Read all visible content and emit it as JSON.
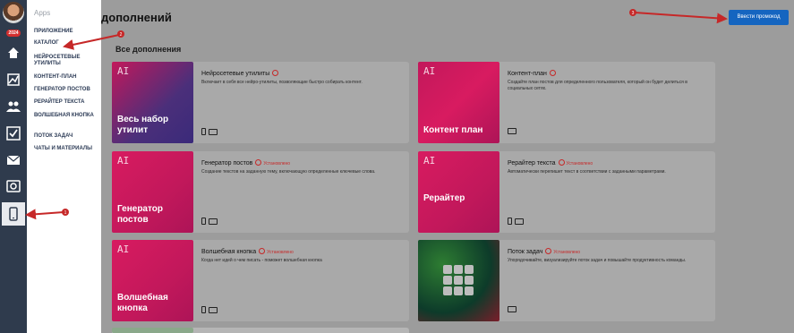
{
  "sidebar": {
    "badge": "2024",
    "apps_title": "Apps",
    "items": [
      {
        "label": "ПРИЛОЖЕНИЕ"
      },
      {
        "label": "КАТАЛОГ"
      },
      {
        "label": "НЕЙРОСЕТЕВЫЕ УТИЛИТЫ"
      },
      {
        "label": "КОНТЕНТ-ПЛАН"
      },
      {
        "label": "ГЕНЕРАТОР ПОСТОВ"
      },
      {
        "label": "РЕРАЙТЕР ТЕКСТА"
      },
      {
        "label": "ВОЛШЕБНАЯ КНОПКА"
      },
      {
        "label": "ПОТОК ЗАДАЧ"
      },
      {
        "label": "ЧАТЫ И МАТЕРИАЛЫ"
      }
    ]
  },
  "header": {
    "title": "дополнений",
    "promo_button": "Ввести промокод"
  },
  "section_title": "Все дополнения",
  "installed_label": "Установлено",
  "cards": [
    {
      "thumb_ai": "AI",
      "thumb_text": "Весь набор утилит",
      "title": "Нейросетевые утилиты",
      "desc": "Включает в себя все нейро-утилиты, позволяющие быстро собирать контент.",
      "thumb_color": "#4b2f7a"
    },
    {
      "thumb_ai": "AI",
      "thumb_text": "Контент план",
      "title": "Контент-план",
      "desc": "Создайте план постов для определенного пользователя, который он будет делиться в социальных сетях.",
      "thumb_color": "#c2185b"
    },
    {
      "thumb_ai": "AI",
      "thumb_text": "Генератор постов",
      "title": "Генератор постов",
      "desc": "Создание текстов на заданную тему, включающую определенные ключевые слова.",
      "thumb_color": "#c2185b"
    },
    {
      "thumb_ai": "AI",
      "thumb_text": "Рерайтер",
      "title": "Рерайтер текста",
      "desc": "Автоматически перепишет текст в соответствии с заданными параметрами.",
      "thumb_color": "#c2185b"
    },
    {
      "thumb_ai": "AI",
      "thumb_text": "Волшебная кнопка",
      "title": "Волшебная кнопка",
      "desc": "Когда нет идей о чем писать - поможет волшебная кнопка",
      "thumb_color": "#c2185b"
    },
    {
      "thumb_ai": "",
      "thumb_text": "",
      "title": "Поток задач",
      "desc": "Упорядочивайте, визуализируйте поток задач и повышайте продуктивность команды.",
      "thumb_color": "#1b5e3b"
    }
  ],
  "markers": {
    "m1": "1",
    "m2": "2",
    "m3": "3"
  },
  "colors": {
    "rail": "#2f3b4d",
    "accent": "#1565c0",
    "arrow": "#c62828",
    "thumb_pink": "#c2185b"
  }
}
